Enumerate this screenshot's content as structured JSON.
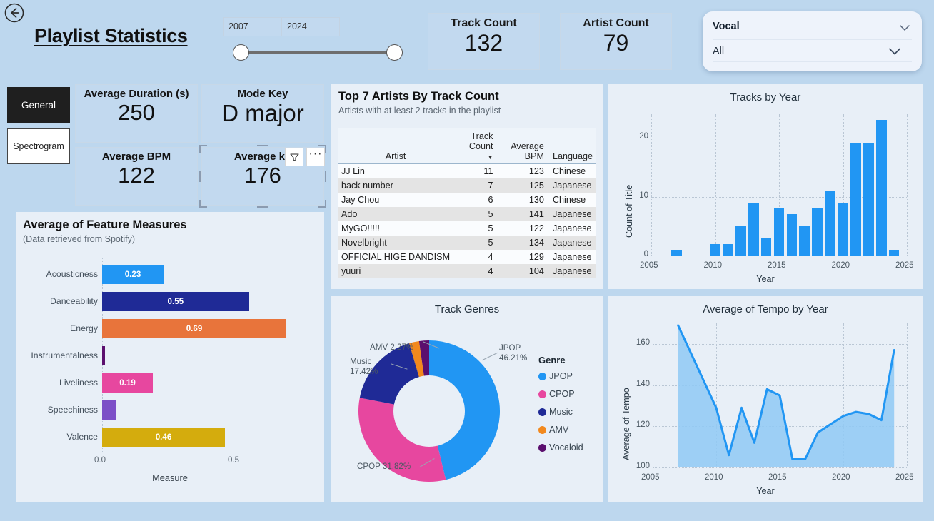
{
  "header": {
    "back_icon": "back-circle-arrow-icon",
    "title": "Playlist Statistics",
    "year_min": "2007",
    "year_max": "2024"
  },
  "top_cards": [
    {
      "label": "Track Count",
      "value": "132"
    },
    {
      "label": "Artist Count",
      "value": "79"
    }
  ],
  "vocal_slicer": {
    "label": "Vocal",
    "selected": "All",
    "chevron_icon": "chevron-down-icon"
  },
  "nav": {
    "general": "General",
    "spectrogram": "Spectrogram"
  },
  "kpis": [
    {
      "label": "Average Duration (s)",
      "value": "250"
    },
    {
      "label": "Mode Key",
      "value": "D major"
    },
    {
      "label": "Average BPM",
      "value": "122"
    },
    {
      "label": "Average kb",
      "value": "176"
    }
  ],
  "visual_header_buttons": {
    "filter_icon": "funnel-filter-icon",
    "more_label": "···"
  },
  "artists_table": {
    "title": "Top 7 Artists By Track Count",
    "subtitle": "Artists with at least 2 tracks in the playlist",
    "columns": [
      "Artist",
      "Track Count",
      "Average BPM",
      "Language"
    ],
    "sorted_by": "Track Count",
    "sort_caret": "▼",
    "rows": [
      [
        "JJ Lin",
        "11",
        "123",
        "Chinese"
      ],
      [
        "back number",
        "7",
        "125",
        "Japanese"
      ],
      [
        "Jay Chou",
        "6",
        "130",
        "Chinese"
      ],
      [
        "Ado",
        "5",
        "141",
        "Japanese"
      ],
      [
        "MyGO!!!!!",
        "5",
        "122",
        "Japanese"
      ],
      [
        "Novelbright",
        "5",
        "134",
        "Japanese"
      ],
      [
        "OFFICIAL HIGE DANDISM",
        "4",
        "129",
        "Japanese"
      ],
      [
        "yuuri",
        "4",
        "104",
        "Japanese"
      ]
    ]
  },
  "colors": {
    "page_bg": "#bdd7ee",
    "panel_bg": "#e8eff7",
    "card_bg": "#c2d9ef",
    "accent_blue": "#2196f3",
    "dark_blue": "#1f2a96",
    "orange": "#e8743b",
    "magenta": "#e7479f",
    "purple": "#7c4fc7",
    "dark_purple": "#5b0f6e",
    "gold": "#d4ac0d"
  },
  "chart_data": [
    {
      "id": "feature-measures",
      "type": "bar",
      "orientation": "horizontal",
      "title": "Average of Feature Measures",
      "subtitle": "(Data retrieved from Spotify)",
      "xlabel": "Measure",
      "ylabel": "",
      "categories": [
        "Acousticness",
        "Danceability",
        "Energy",
        "Instrumentalness",
        "Liveliness",
        "Speechiness",
        "Valence"
      ],
      "values": [
        0.23,
        0.55,
        0.69,
        0.01,
        0.19,
        0.05,
        0.46
      ],
      "data_labels": [
        "0.23",
        "0.55",
        "0.69",
        "",
        "0.19",
        "",
        "0.46"
      ],
      "bar_colors": [
        "#2196f3",
        "#1f2a96",
        "#e8743b",
        "#5b0f6e",
        "#e7479f",
        "#7c4fc7",
        "#d4ac0d"
      ],
      "xticks": [
        "0.0",
        "0.5"
      ],
      "xtick_values": [
        0.0,
        0.5
      ],
      "xlim": [
        0,
        0.77
      ],
      "grid": true,
      "legend": "none"
    },
    {
      "id": "tracks-by-year",
      "type": "bar",
      "orientation": "vertical",
      "title": "Tracks by Year",
      "xlabel": "Year",
      "ylabel": "Count of Title",
      "categories": [
        2007,
        2010,
        2011,
        2012,
        2013,
        2014,
        2015,
        2016,
        2017,
        2018,
        2019,
        2020,
        2021,
        2022,
        2023,
        2024
      ],
      "values": [
        1,
        2,
        2,
        5,
        9,
        3,
        8,
        7,
        5,
        8,
        11,
        9,
        19,
        19,
        23,
        1
      ],
      "xticks": [
        "2005",
        "2010",
        "2015",
        "2020",
        "2025"
      ],
      "yticks": [
        "0",
        "10",
        "20"
      ],
      "xlim": [
        2005,
        2025
      ],
      "ylim": [
        0,
        24
      ],
      "grid": true,
      "bar_color": "#2196f3",
      "legend": "none"
    },
    {
      "id": "track-genres",
      "type": "pie",
      "subtype": "donut",
      "title": "Track Genres",
      "legend_title": "Genre",
      "legend_position": "right",
      "labels": [
        "JPOP",
        "CPOP",
        "Music",
        "AMV",
        "Vocaloid"
      ],
      "values": [
        46.21,
        31.82,
        17.42,
        2.27,
        2.28
      ],
      "colors": [
        "#2196f3",
        "#e7479f",
        "#1f2a96",
        "#f2891e",
        "#5b0f6e"
      ],
      "callouts": [
        {
          "text": "JPOP\n46.21%",
          "label": "JPOP 46.21%"
        },
        {
          "text": "CPOP 31.82%",
          "label": "CPOP 31.82%"
        },
        {
          "text": "Music\n17.42%",
          "label": "Music 17.42%"
        },
        {
          "text": "AMV 2.27%",
          "label": "AMV 2.27%"
        }
      ],
      "callout_jpop_l1": "JPOP",
      "callout_jpop_l2": "46.21%",
      "callout_cpop": "CPOP 31.82%",
      "callout_music_l1": "Music",
      "callout_music_l2": "17.42%",
      "callout_amv": "AMV 2.27%"
    },
    {
      "id": "avg-tempo-by-year",
      "type": "area",
      "title": "Average of Tempo by Year",
      "xlabel": "Year",
      "ylabel": "Average of Tempo",
      "x": [
        2007,
        2010,
        2011,
        2012,
        2013,
        2014,
        2015,
        2016,
        2017,
        2018,
        2019,
        2020,
        2021,
        2022,
        2023,
        2024
      ],
      "values": [
        169,
        129,
        106,
        129,
        112,
        138,
        135,
        104,
        104,
        117,
        121,
        125,
        127,
        126,
        123,
        157
      ],
      "xticks": [
        "2005",
        "2010",
        "2015",
        "2020",
        "2025"
      ],
      "yticks": [
        "100",
        "120",
        "140",
        "160"
      ],
      "xlim": [
        2005,
        2025
      ],
      "ylim": [
        100,
        170
      ],
      "grid": true,
      "line_color": "#2196f3",
      "fill_color": "#8fc9f5",
      "legend": "none"
    }
  ]
}
